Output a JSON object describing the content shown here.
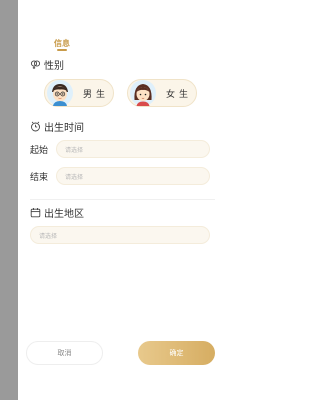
{
  "tab": {
    "label": "信息"
  },
  "gender": {
    "title": "性别",
    "male": "男生",
    "female": "女生"
  },
  "birth_time": {
    "title": "出生时间",
    "start_label": "起始",
    "start_placeholder": "请选择",
    "end_label": "结束",
    "end_placeholder": "请选择"
  },
  "birth_place": {
    "title": "出生地区",
    "placeholder": "请选择"
  },
  "actions": {
    "cancel": "取消",
    "confirm": "确定"
  },
  "colors": {
    "accent": "#c89b4a",
    "field_bg": "#fbf7ef",
    "confirm_gradient_start": "#e8c98c",
    "confirm_gradient_end": "#d6ad62"
  }
}
